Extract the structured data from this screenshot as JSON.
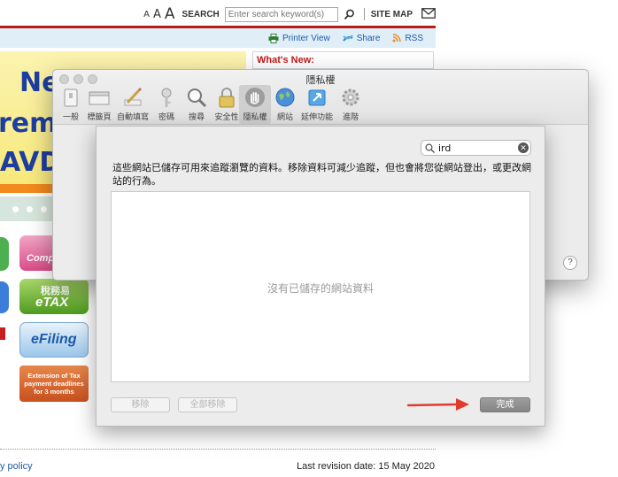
{
  "site": {
    "font_size_small": "A",
    "font_size_medium": "A",
    "font_size_large": "A",
    "search_label": "SEARCH",
    "search_placeholder": "Enter search keyword(s)",
    "site_map": "SITE MAP",
    "printer_view": "Printer View",
    "share": "Share",
    "rss": "RSS",
    "whats_new": "What's New:",
    "banner_line1": "Ne",
    "banner_line2": "rem",
    "banner_line3": "AVD",
    "pink_button_text": "Comp",
    "etax_line1": "稅務易",
    "etax_line2": "eTAX",
    "efiling": "eFiling",
    "extension_notice": "Extension of Tax payment deadlines for 3 months",
    "footer_link": "y policy",
    "last_revision": "Last revision date: 15 May 2020"
  },
  "prefs": {
    "title": "隱私權",
    "toolbar": [
      {
        "label": "一般",
        "icon": "general-icon"
      },
      {
        "label": "標籤頁",
        "icon": "tabs-icon"
      },
      {
        "label": "自動填寫",
        "icon": "autofill-icon"
      },
      {
        "label": "密碼",
        "icon": "passwords-icon"
      },
      {
        "label": "搜尋",
        "icon": "search-icon"
      },
      {
        "label": "安全性",
        "icon": "security-icon"
      },
      {
        "label": "隱私權",
        "icon": "privacy-icon",
        "selected": true
      },
      {
        "label": "網站",
        "icon": "websites-icon"
      },
      {
        "label": "延伸功能",
        "icon": "extensions-icon"
      },
      {
        "label": "進階",
        "icon": "advanced-icon"
      }
    ],
    "help": "?"
  },
  "sheet": {
    "search_value": "ird",
    "description": "這些網站已儲存可用來追蹤瀏覽的資料。移除資料可減少追蹤，但也會將您從網站登出，或更改網站的行為。",
    "empty_message": "沒有已儲存的網站資料",
    "remove_label": "移除",
    "remove_all_label": "全部移除",
    "done_label": "完成"
  },
  "colors": {
    "site_red": "#b71c1c",
    "site_link_blue": "#1e5aa8",
    "annotation_arrow": "#e23b2e"
  }
}
